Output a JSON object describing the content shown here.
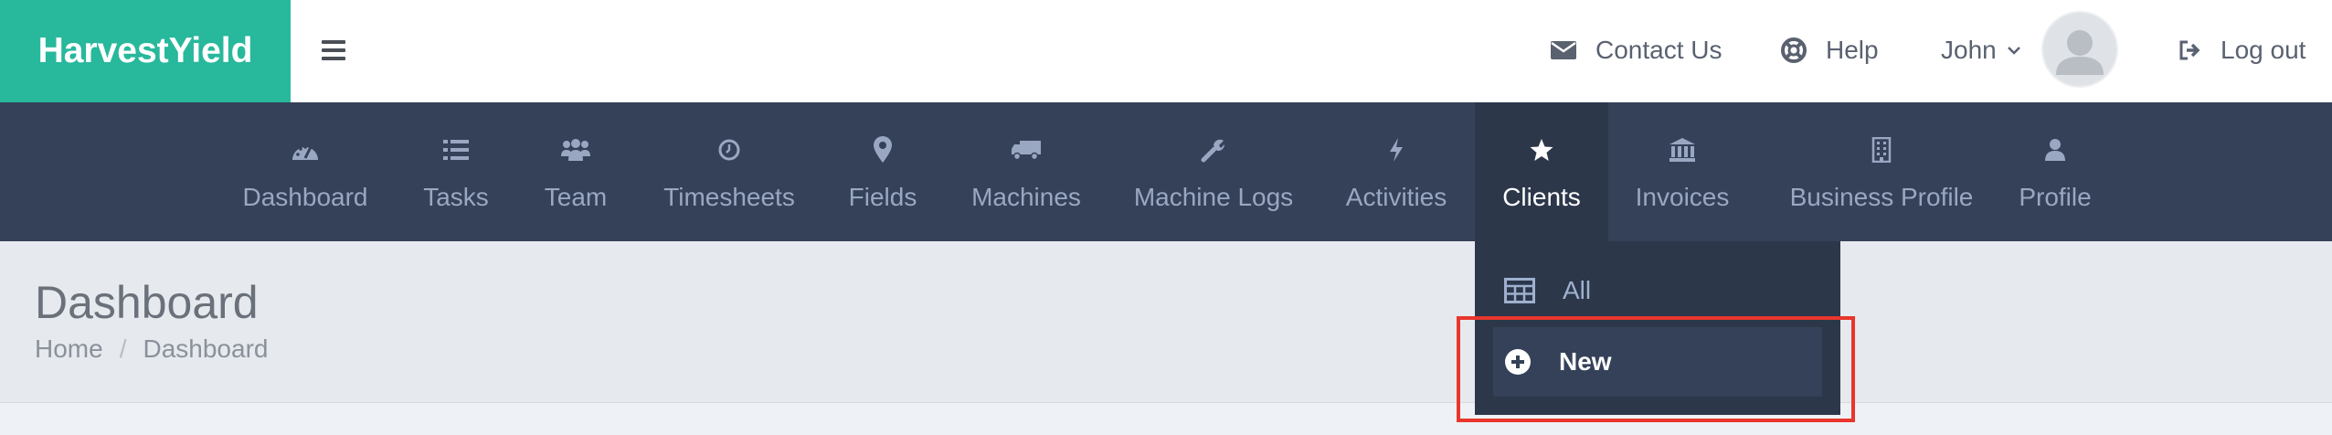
{
  "brand": {
    "name": "HarvestYield",
    "color": "#28b89c"
  },
  "header": {
    "menu_icon": "hamburger-icon",
    "contact": {
      "label": "Contact Us",
      "icon": "envelope-icon"
    },
    "help": {
      "label": "Help",
      "icon": "lifebuoy-icon"
    },
    "user": {
      "name": "John",
      "icon": "chevron-down-icon"
    },
    "logout": {
      "label": "Log out",
      "icon": "sign-out-icon"
    }
  },
  "nav": {
    "items": [
      {
        "label": "Dashboard",
        "icon": "dashboard-icon"
      },
      {
        "label": "Tasks",
        "icon": "list-icon"
      },
      {
        "label": "Team",
        "icon": "users-icon"
      },
      {
        "label": "Timesheets",
        "icon": "clock-icon"
      },
      {
        "label": "Fields",
        "icon": "map-marker-icon"
      },
      {
        "label": "Machines",
        "icon": "truck-icon"
      },
      {
        "label": "Machine Logs",
        "icon": "wrench-icon"
      },
      {
        "label": "Activities",
        "icon": "bolt-icon"
      },
      {
        "label": "Clients",
        "icon": "star-icon",
        "active": true
      },
      {
        "label": "Invoices",
        "icon": "bank-icon"
      },
      {
        "label": "Business Profile",
        "icon": "building-icon"
      },
      {
        "label": "Profile",
        "icon": "user-icon"
      }
    ]
  },
  "clients_dropdown": {
    "items": [
      {
        "label": "All",
        "icon": "table-icon"
      },
      {
        "label": "New",
        "icon": "plus-circle-icon",
        "highlighted": true
      }
    ]
  },
  "page": {
    "title": "Dashboard",
    "breadcrumb": [
      "Home",
      "Dashboard"
    ]
  },
  "colors": {
    "nav_bg": "#344158",
    "nav_active_bg": "#2c374a",
    "highlight_border": "#e8362c"
  }
}
